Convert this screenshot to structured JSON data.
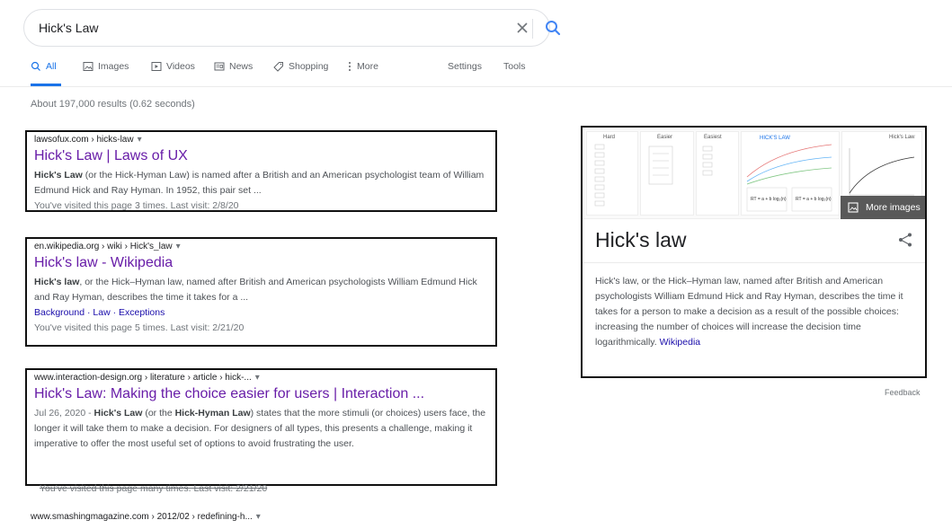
{
  "search": {
    "query": "Hick's Law"
  },
  "tabs": [
    {
      "label": "All",
      "icon": "search-icon"
    },
    {
      "label": "Images",
      "icon": "image-icon"
    },
    {
      "label": "Videos",
      "icon": "video-icon"
    },
    {
      "label": "News",
      "icon": "news-icon"
    },
    {
      "label": "Shopping",
      "icon": "tag-icon"
    },
    {
      "label": "More",
      "icon": "more-vert-icon"
    },
    {
      "label": "Settings"
    },
    {
      "label": "Tools"
    }
  ],
  "results_count": "About 197,000 results (0.62 seconds)",
  "results": [
    {
      "url": "lawsofux.com › hicks-law",
      "title": "Hick's Law | Laws of UX",
      "snippet_bold": "Hick's Law",
      "snippet": " (or the Hick-Hyman Law) is named after a British and an American psychologist team of William Edmund Hick and Ray Hyman. In 1952, this pair set ...",
      "visited": "You've visited this page 3 times. Last visit: 2/8/20"
    },
    {
      "url": "en.wikipedia.org › wiki › Hick's_law",
      "title": "Hick's law - Wikipedia",
      "snippet_bold": "Hick's law",
      "snippet": ", or the Hick–Hyman law, named after British and American psychologists William Edmund Hick and Ray Hyman, describes the time it takes for a ...",
      "sitelinks": [
        "Background",
        "Law",
        "Exceptions"
      ],
      "visited": "You've visited this page 5 times. Last visit: 2/21/20"
    },
    {
      "url": "www.interaction-design.org › literature › article › hick-...",
      "title": "Hick's Law: Making the choice easier for users | Interaction ...",
      "date": "Jul 26, 2020 - ",
      "snippet_bold": "Hick's Law",
      "snippet_mid": " (or the ",
      "snippet_bold2": "Hick-Hyman Law",
      "snippet": ") states that the more stimuli (or choices) users face, the longer it will take them to make a decision. For designers of all types, this presents a challenge, making it imperative to offer the most useful set of options to avoid frustrating the user.",
      "visited": "You've visited this page many times. Last visit: 2/21/20"
    }
  ],
  "bottom_url": "www.smashingmagazine.com › 2012/02 › redefining-h...",
  "knowledge_panel": {
    "more_images": "More images",
    "title": "Hick's law",
    "description": "Hick's law, or the Hick–Hyman law, named after British and American psychologists William Edmund Hick and Ray Hyman, describes the time it takes for a person to make a decision as a result of the possible choices: increasing the number of choices will increase the decision time logarithmically.",
    "source": "Wikipedia",
    "thumb_labels": [
      "Hard",
      "Easier",
      "Easiest",
      "Hick's Law"
    ]
  },
  "feedback": "Feedback",
  "colors": {
    "link_visited": "#681da8",
    "accent": "#1a73e8",
    "link": "#1a0dab"
  }
}
